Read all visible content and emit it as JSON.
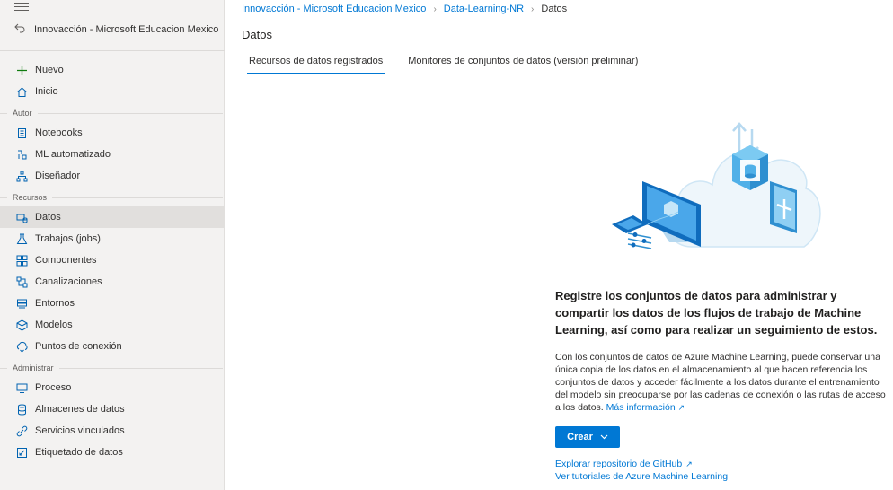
{
  "sidebar": {
    "workspace_link": "Innovacción - Microsoft Educacion Mexico",
    "items_top": [
      {
        "label": "Nuevo",
        "icon": "plus-icon"
      },
      {
        "label": "Inicio",
        "icon": "home-icon"
      }
    ],
    "section_author": "Autor",
    "items_author": [
      {
        "label": "Notebooks",
        "icon": "notebook-icon"
      },
      {
        "label": "ML automatizado",
        "icon": "automl-icon"
      },
      {
        "label": "Diseñador",
        "icon": "designer-icon"
      }
    ],
    "section_resources": "Recursos",
    "items_resources": [
      {
        "label": "Datos",
        "icon": "data-icon",
        "active": true
      },
      {
        "label": "Trabajos (jobs)",
        "icon": "flask-icon"
      },
      {
        "label": "Componentes",
        "icon": "components-icon"
      },
      {
        "label": "Canalizaciones",
        "icon": "pipeline-icon"
      },
      {
        "label": "Entornos",
        "icon": "environment-icon"
      },
      {
        "label": "Modelos",
        "icon": "model-icon"
      },
      {
        "label": "Puntos de conexión",
        "icon": "endpoint-icon"
      }
    ],
    "section_manage": "Administrar",
    "items_manage": [
      {
        "label": "Proceso",
        "icon": "compute-icon"
      },
      {
        "label": "Almacenes de datos",
        "icon": "datastore-icon"
      },
      {
        "label": "Servicios vinculados",
        "icon": "linked-services-icon"
      },
      {
        "label": "Etiquetado de datos",
        "icon": "labeling-icon"
      }
    ]
  },
  "breadcrumb": {
    "items": [
      "Innovacción - Microsoft Educacion Mexico",
      "Data-Learning-NR"
    ],
    "current": "Datos"
  },
  "page": {
    "title": "Datos",
    "tabs": [
      "Recursos de datos registrados",
      "Monitores de conjuntos de datos (versión preliminar)"
    ]
  },
  "empty_state": {
    "heading": "Registre los conjuntos de datos para administrar y compartir los datos de los flujos de trabajo de Machine Learning, así como para realizar un seguimiento de estos.",
    "body": "Con los conjuntos de datos de Azure Machine Learning, puede conservar una única copia de los datos en el almacenamiento al que hacen referencia los conjuntos de datos y acceder fácilmente a los datos durante el entrenamiento del modelo sin preocuparse por las cadenas de conexión o las rutas de acceso a los datos.",
    "more_info": "Más información",
    "create_button": "Crear",
    "link_github": "Explorar repositorio de GitHub",
    "link_tutorials": "Ver tutoriales de Azure Machine Learning"
  },
  "colors": {
    "accent": "#0078d4",
    "sidebar_bg": "#f3f2f1",
    "active_bg": "#e1dfdd"
  }
}
